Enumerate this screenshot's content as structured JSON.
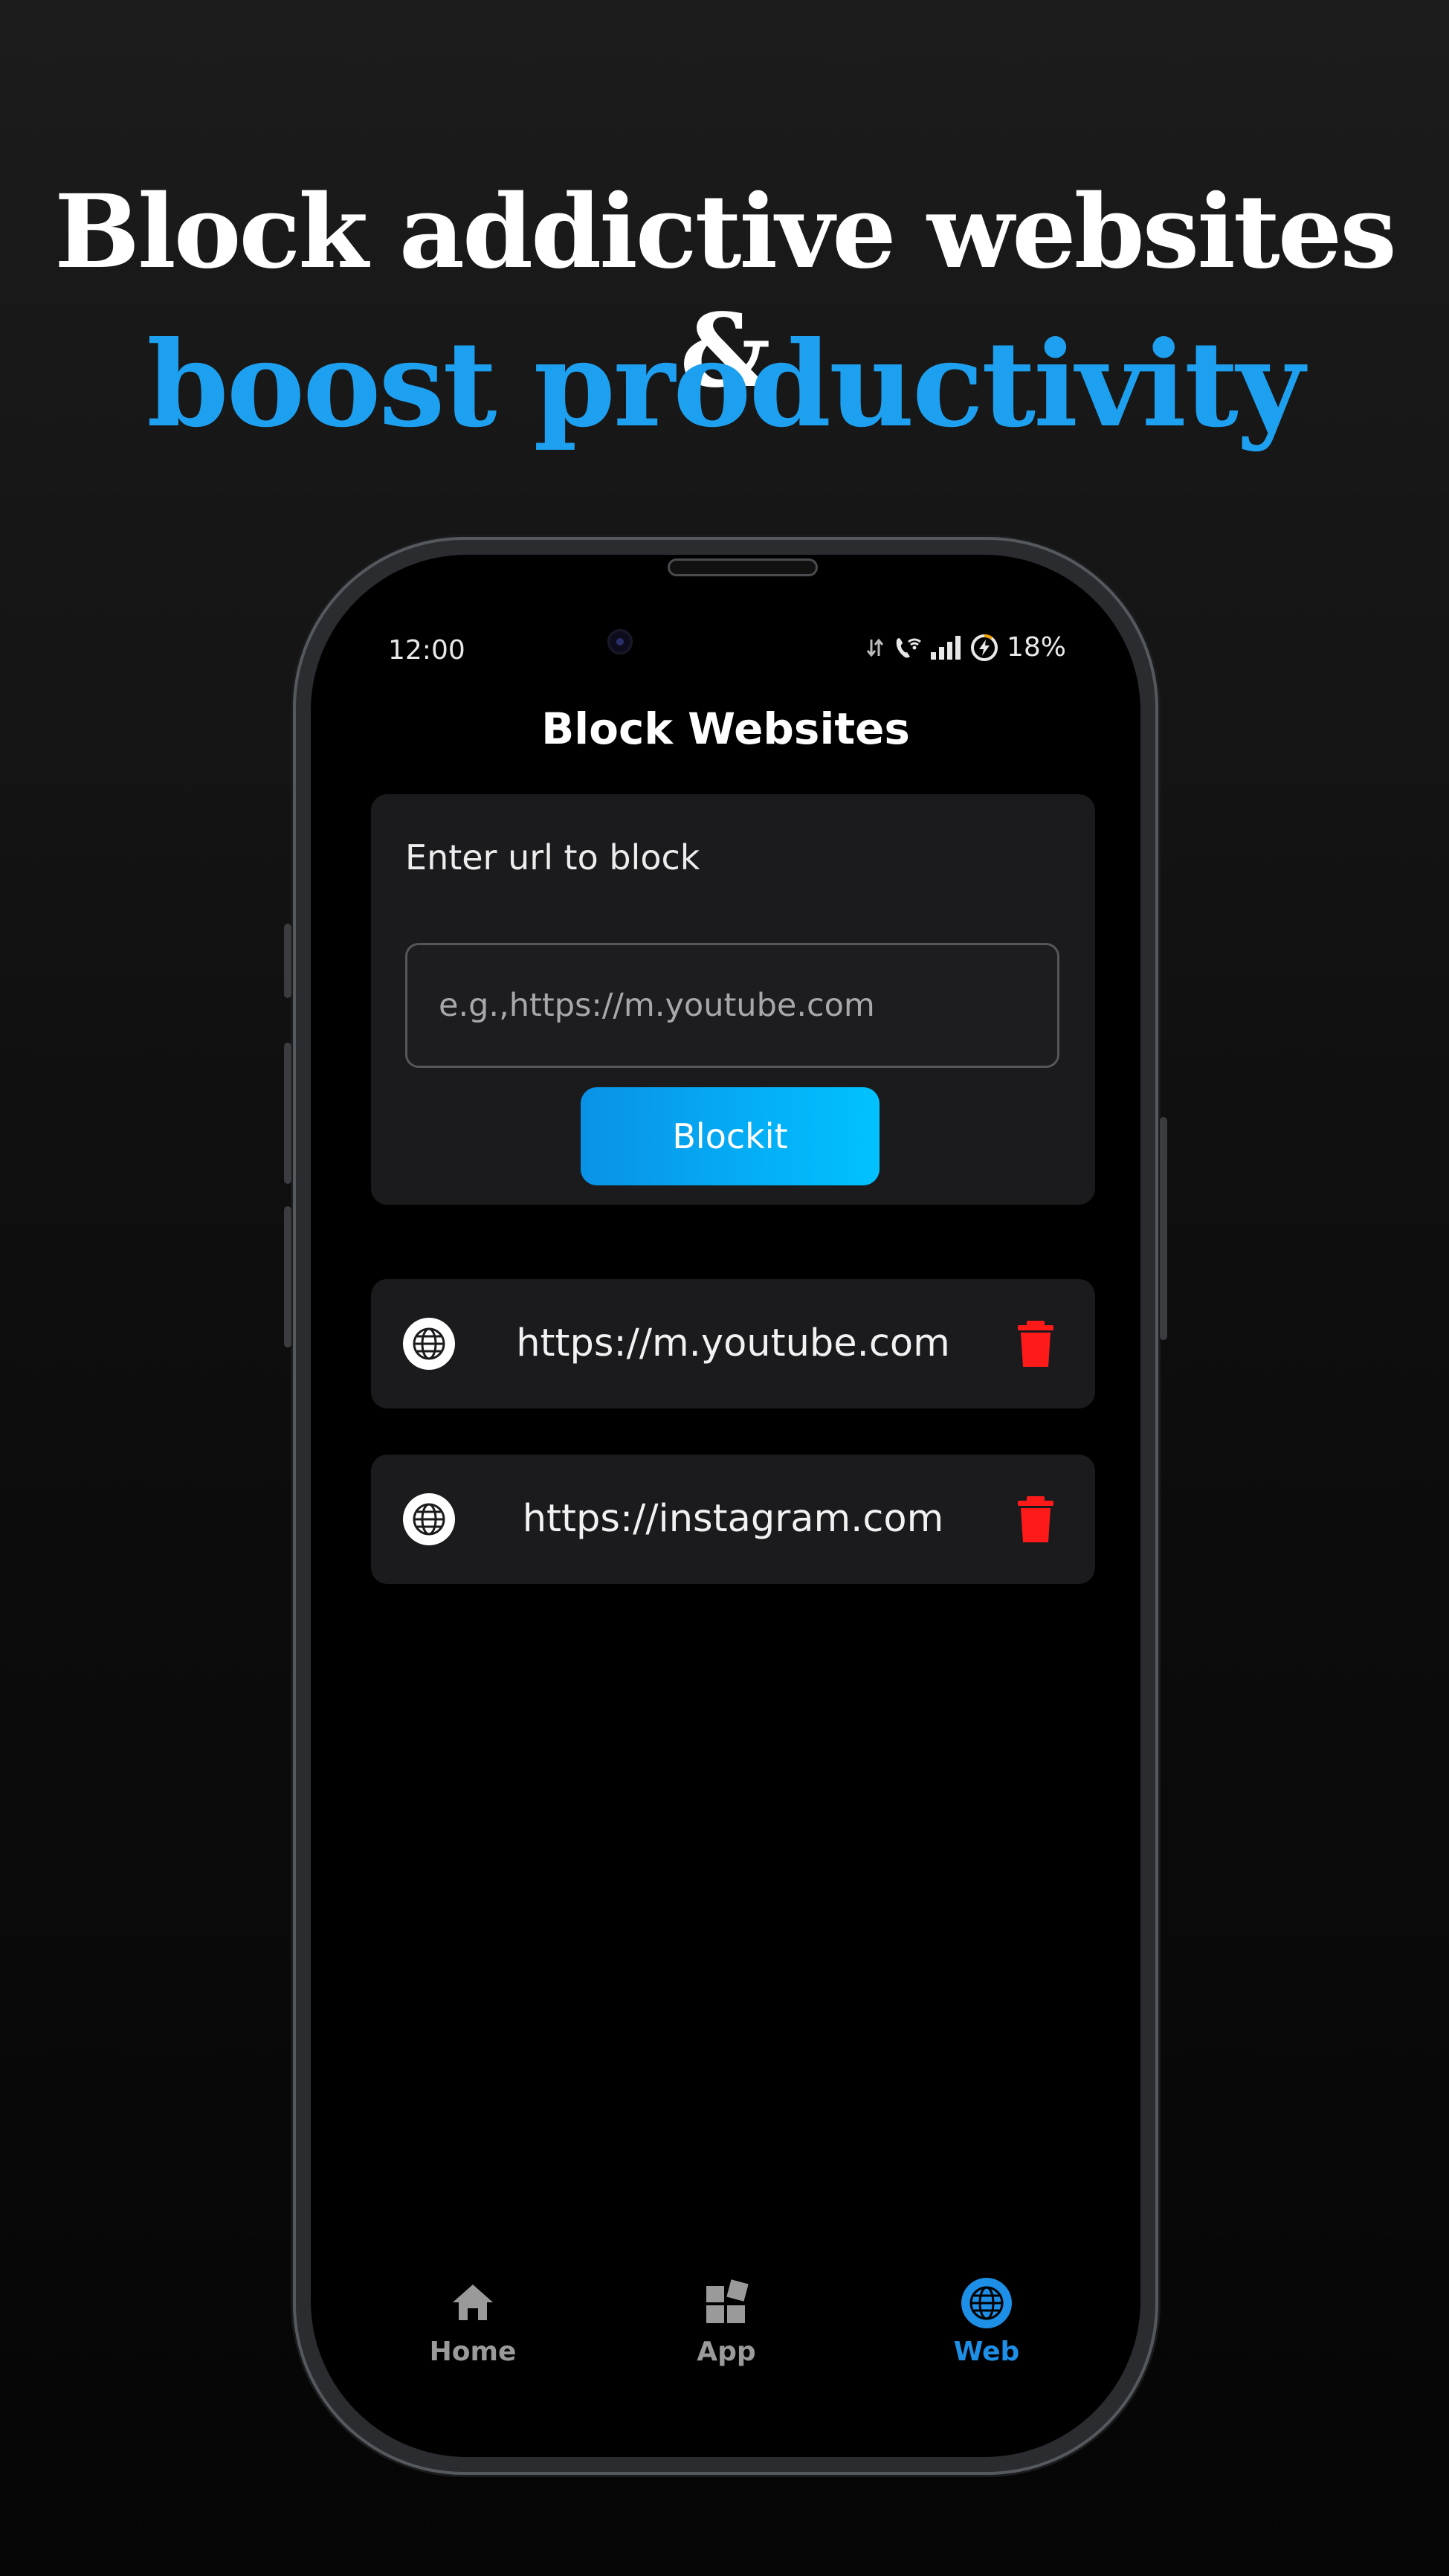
{
  "headline": {
    "line1": "Block addictive websites &",
    "line2": "boost productivity"
  },
  "status_bar": {
    "time": "12:00",
    "battery_percent": "18%",
    "icons": [
      "data-arrows-icon",
      "wifi-calling-icon",
      "signal-bars-icon",
      "battery-charging-icon"
    ]
  },
  "app": {
    "title": "Block Websites",
    "form": {
      "label": "Enter url to block",
      "input_value": "",
      "input_placeholder": "e.g.,https://m.youtube.com",
      "button_label": "Blockit"
    },
    "blocked_sites": [
      {
        "url": "https://m.youtube.com",
        "icon": "globe-icon",
        "action_icon": "trash-icon"
      },
      {
        "url": "https://instagram.com",
        "icon": "globe-icon",
        "action_icon": "trash-icon"
      }
    ]
  },
  "bottom_nav": {
    "items": [
      {
        "label": "Home",
        "icon": "home-icon",
        "active": false
      },
      {
        "label": "App",
        "icon": "apps-icon",
        "active": false
      },
      {
        "label": "Web",
        "icon": "globe-icon",
        "active": true
      }
    ]
  },
  "colors": {
    "accent": "#1ea0f0",
    "delete": "#ff1a1a",
    "card_bg": "#1b1b1e",
    "screen_bg": "#000000"
  }
}
